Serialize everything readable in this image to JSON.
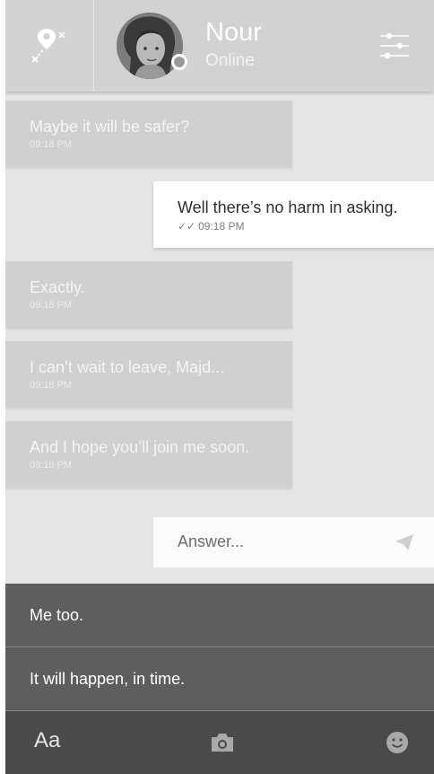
{
  "header": {
    "contact_name": "Nour",
    "contact_status": "Online"
  },
  "messages": [
    {
      "direction": "in",
      "text": "Maybe it will be safer?",
      "time": "09:18 PM"
    },
    {
      "direction": "out",
      "text": "Well there’s no harm in asking.",
      "time": "09:18 PM",
      "ticks": "✓✓"
    },
    {
      "direction": "in",
      "text": "Exactly.",
      "time": "09:18 PM"
    },
    {
      "direction": "in",
      "text": "I can’t wait to leave, Majd...",
      "time": "09:18 PM"
    },
    {
      "direction": "in",
      "text": "And I hope you’ll join me soon.",
      "time": "09:18 PM"
    }
  ],
  "composer": {
    "placeholder": "Answer..."
  },
  "choices": [
    {
      "label": "Me too."
    },
    {
      "label": "It will happen, in time."
    }
  ],
  "bottom_bar": {
    "font_label": "Aa"
  },
  "icons": {
    "map": "map-pin-route-icon",
    "settings": "sliders-icon",
    "send": "paper-plane-icon",
    "camera": "camera-icon",
    "emoji": "smiley-icon"
  },
  "colors": {
    "header_bg": "#d2d2d2",
    "chat_bg": "#e4e4e4",
    "incoming_bubble": "#d0d0d0",
    "outgoing_bubble": "#ffffff",
    "choices_bg": "#5e5e5e",
    "bottom_bar_bg": "#4a4a4a"
  }
}
